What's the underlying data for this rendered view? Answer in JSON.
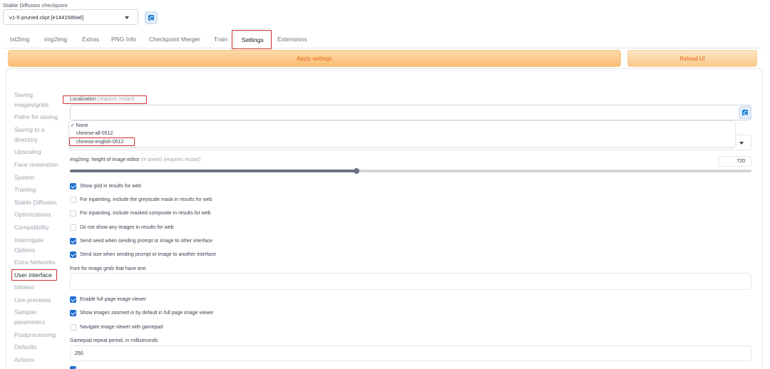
{
  "checkpoint": {
    "label": "Stable Diffusion checkpoint",
    "value": "v1-5-pruned.ckpt [e1441589a6]"
  },
  "tabs": [
    "txt2img",
    "img2img",
    "Extras",
    "PNG Info",
    "Checkpoint Merger",
    "Train",
    "Settings",
    "Extensions"
  ],
  "active_tab": "Settings",
  "buttons": {
    "apply": "Apply settings",
    "reload": "Reload UI"
  },
  "sidebar": [
    "Saving",
    "images/grids",
    "Paths for saving",
    "Saving to a",
    "directory",
    "Upscaling",
    "Face restoration",
    "System",
    "Training",
    "Stable Diffusion",
    "Optimizations",
    "Compatibility",
    "Interrogate",
    "Options",
    "Extra Networks",
    "User interface",
    "Infotext",
    "Live previews",
    "Sampler",
    "parameters",
    "Postprocessing",
    "Defaults",
    "Actions"
  ],
  "sidebar_active": "User interface",
  "localization": {
    "label": "Localization",
    "note": "(requires restart)",
    "options": [
      "✓ None",
      "chinese-all-0512",
      "chinese-english-0512"
    ]
  },
  "img2img_height": {
    "label": "img2img: height of image editor",
    "note": "(in pixels) (requires restart)",
    "value": "720",
    "fraction": 0.42
  },
  "checkboxes_a": [
    {
      "label": "Show grid in results for web",
      "checked": true
    },
    {
      "label": "For inpainting, include the greyscale mask in results for web",
      "checked": false
    },
    {
      "label": "For inpainting, include masked composite in results for web",
      "checked": false
    },
    {
      "label": "Do not show any images in results for web",
      "checked": false
    },
    {
      "label": "Send seed when sending prompt or image to other interface",
      "checked": true
    },
    {
      "label": "Send size when sending prompt or image to another interface",
      "checked": true
    }
  ],
  "font_grids": {
    "label": "Font for image grids that have text",
    "value": ""
  },
  "checkboxes_b": [
    {
      "label": "Enable full page image viewer",
      "checked": true
    },
    {
      "label": "Show images zoomed in by default in full page image viewer",
      "checked": true
    },
    {
      "label": "Navigate image viewer with gamepad",
      "checked": false
    }
  ],
  "gamepad": {
    "label": "Gamepad repeat period, in milliseconds",
    "value": "250"
  },
  "colors": {
    "accent": "#1d6fd1",
    "button_text": "#e4661b",
    "highlight": "#d32f2f"
  }
}
